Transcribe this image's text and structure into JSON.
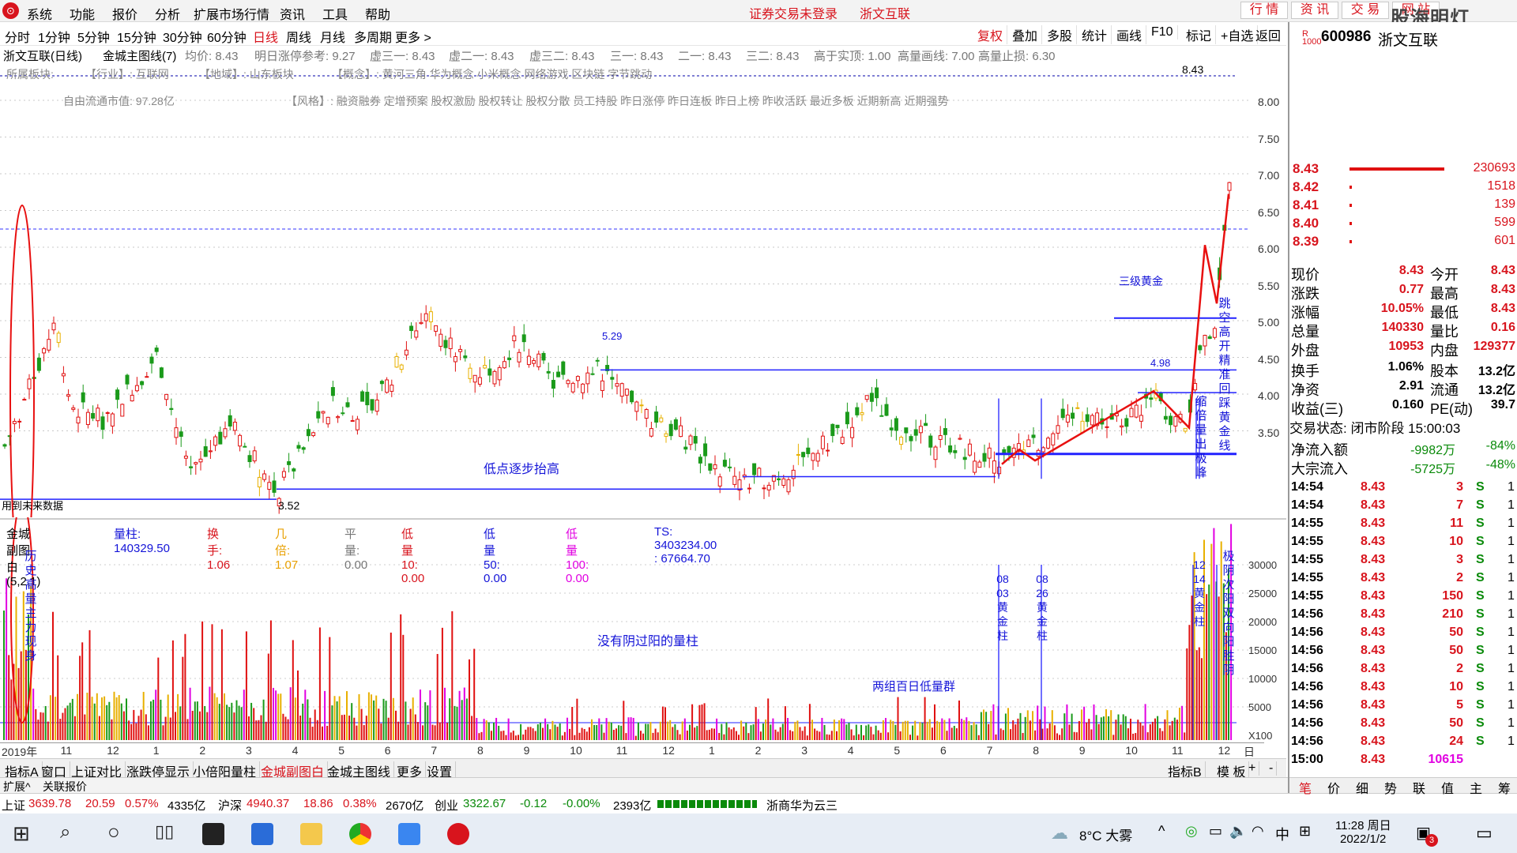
{
  "menu": [
    "系统",
    "功能",
    "报价",
    "分析",
    "扩展市场行情",
    "资讯",
    "工具",
    "帮助"
  ],
  "login_status": "证券交易未登录",
  "stock_name_top": "浙文互联",
  "right_buttons": [
    "行 情",
    "资 讯",
    "交 易",
    "网 站"
  ],
  "watermark": "股海明灯",
  "periods": [
    "分时",
    "1分钟",
    "5分钟",
    "15分钟",
    "30分钟",
    "60分钟",
    "日线",
    "周线",
    "月线",
    "多周期",
    "更多 >"
  ],
  "toolbar": [
    "复权",
    "叠加",
    "多股",
    "统计",
    "画线",
    "F10",
    "标记",
    "+自选",
    "返回"
  ],
  "header_line": [
    "浙文互联(日线)",
    "金城主图线(7)",
    "均价: 8.43",
    "明日涨停参考: 9.27",
    "虚三一: 8.43",
    "虚二一: 8.43",
    "虚三二: 8.43",
    "三一: 8.43",
    "二一: 8.43",
    "三二: 8.43",
    "高于实顶: 1.00",
    "高量画线: 7.00",
    "高量止损: 6.30"
  ],
  "info_lines": [
    "所属板块:",
    "【行业】: 互联网",
    "【地域】: 山东板块",
    "【概念】: 黄河三角 华为概念 小米概念 网络游戏 区块链 字节跳动",
    "自由流通市值: 97.28亿",
    "【风格】: 融资融券 定增预案 股权激励 股权转让 股权分散 员工持股 昨日涨停 昨日连板 昨日上榜 昨收活跃 最近多板 近期新高 近期强势"
  ],
  "price_axis": [
    "8.00",
    "7.50",
    "7.00",
    "6.50",
    "6.00",
    "5.50",
    "5.00",
    "4.50",
    "4.00",
    "3.50"
  ],
  "vol_axis": [
    "30000",
    "25000",
    "20000",
    "15000",
    "10000",
    "5000",
    "X100"
  ],
  "annotations": {
    "low_rise": "低点逐步抬高",
    "no_yin": "没有阴过阳的量柱",
    "two_groups": "两组百日低量群",
    "third_gold": "三级黄金",
    "history_vol": "历史高量主力现身",
    "jump": "跳空高开精准回踩黄金线",
    "shrink": "缩倍量出极峰",
    "yin_yang": "极阴次阳双向阳胜阴",
    "gold_0803": "08 03 黄 金 柱",
    "gold_0826": "08 26 黄 金 柱",
    "gold_1214": "12 14 黄 金 柱",
    "p352": "3.52",
    "p529": "5.29",
    "p498": "4.98",
    "p843": "8.43",
    "future": "用到未来数据"
  },
  "sub_header": [
    "金城副图白(5,2,1)",
    "量柱: 140329.50",
    "换手: 1.06",
    "几倍: 1.07",
    "平量: 0.00",
    "低量10: 0.00",
    "低量50: 0.00",
    "低量100: 0.00",
    "TS: 3403234.00 : 67664.70"
  ],
  "dates": [
    "2019年",
    "11",
    "12",
    "1",
    "2",
    "3",
    "4",
    "5",
    "6",
    "7",
    "8",
    "9",
    "10",
    "11",
    "12",
    "1",
    "2",
    "3",
    "4",
    "5",
    "6",
    "7",
    "8",
    "9",
    "10",
    "11",
    "12",
    "日线"
  ],
  "tabs": [
    "指标A",
    "窗口",
    "上证对比",
    "涨跌停显示",
    "小倍阳量柱",
    "金城副图白",
    "金城主图线",
    "更多",
    "设置"
  ],
  "tabs_right": [
    "指标B",
    "模 板",
    "+",
    "-"
  ],
  "bottom_links": [
    "扩展^",
    "关联报价"
  ],
  "index_row": {
    "sh_name": "上证",
    "sh_val": "3639.78",
    "sh_chg": "20.59",
    "sh_pct": "0.57%",
    "sh_amt": "4335亿",
    "hs_name": "沪深",
    "hs_val": "4940.37",
    "hs_chg": "18.86",
    "hs_pct": "0.38%",
    "hs_amt": "2670亿",
    "cy_name": "创业",
    "cy_val": "3322.67",
    "cy_chg": "-0.12",
    "cy_pct": "-0.00%",
    "cy_amt": "2393亿",
    "broker": "浙商华为云三"
  },
  "taskbar": {
    "weather": "8°C 大雾",
    "time": "11:28 周日",
    "date": "2022/1/2",
    "ime": "中",
    "notify": "3"
  },
  "quote": {
    "code": "600986",
    "name": "浙文互联",
    "book": [
      [
        "8.43",
        "230693"
      ],
      [
        "8.42",
        "1518"
      ],
      [
        "8.41",
        "139"
      ],
      [
        "8.40",
        "599"
      ],
      [
        "8.39",
        "601"
      ]
    ],
    "stats": [
      [
        "现价",
        "8.43",
        "今开",
        "8.43"
      ],
      [
        "涨跌",
        "0.77",
        "最高",
        "8.43"
      ],
      [
        "涨幅",
        "10.05%",
        "最低",
        "8.43"
      ],
      [
        "总量",
        "140330",
        "量比",
        "0.16"
      ],
      [
        "外盘",
        "10953",
        "内盘",
        "129377"
      ]
    ],
    "stats2": [
      [
        "换手",
        "1.06%",
        "股本",
        "13.2亿"
      ],
      [
        "净资",
        "2.91",
        "流通",
        "13.2亿"
      ],
      [
        "收益(三)",
        "0.160",
        "PE(动)",
        "39.7"
      ]
    ],
    "trade_state": "交易状态: 闭市阶段 15:00:03",
    "flow": [
      [
        "净流入额",
        "-9982万",
        "-84%"
      ],
      [
        "大宗流入",
        "-5725万",
        "-48%"
      ]
    ],
    "ticks": [
      [
        "14:54",
        "8.43",
        "3",
        "S"
      ],
      [
        "14:54",
        "8.43",
        "7",
        "S"
      ],
      [
        "14:55",
        "8.43",
        "11",
        "S"
      ],
      [
        "14:55",
        "8.43",
        "10",
        "S"
      ],
      [
        "14:55",
        "8.43",
        "3",
        "S"
      ],
      [
        "14:55",
        "8.43",
        "2",
        "S"
      ],
      [
        "14:55",
        "8.43",
        "150",
        "S"
      ],
      [
        "14:56",
        "8.43",
        "210",
        "S"
      ],
      [
        "14:56",
        "8.43",
        "50",
        "S"
      ],
      [
        "14:56",
        "8.43",
        "50",
        "S"
      ],
      [
        "14:56",
        "8.43",
        "2",
        "S"
      ],
      [
        "14:56",
        "8.43",
        "10",
        "S"
      ],
      [
        "14:56",
        "8.43",
        "5",
        "S"
      ],
      [
        "14:56",
        "8.43",
        "50",
        "S"
      ],
      [
        "14:56",
        "8.43",
        "24",
        "S"
      ],
      [
        "15:00",
        "8.43",
        "10615",
        ""
      ]
    ],
    "bottom_tabs": [
      "笔",
      "价",
      "细",
      "势",
      "联",
      "值",
      "主",
      "筹"
    ]
  }
}
